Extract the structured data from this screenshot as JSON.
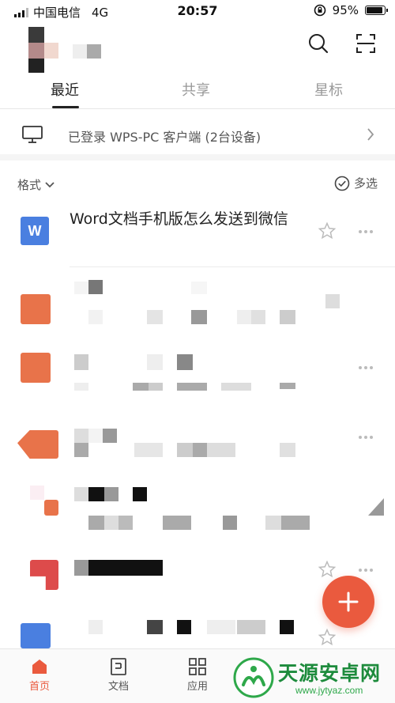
{
  "status_bar": {
    "carrier": "中国电信",
    "network": "4G",
    "time": "20:57",
    "battery": "95%",
    "battery_level": 0.95
  },
  "tabs": [
    {
      "label": "最近"
    },
    {
      "label": "共享"
    },
    {
      "label": "星标"
    }
  ],
  "device_row": {
    "label": "已登录 WPS-PC 客户端 (2台设备)"
  },
  "filter": {
    "format_label": "格式",
    "multi_select_label": "多选"
  },
  "files": [
    {
      "title": "Word文档手机版怎么发送到微信",
      "icon_letter": "W",
      "icon_color": "#4a7fe0"
    }
  ],
  "colors": {
    "accent": "#ea5a3e",
    "word_blue": "#4a7fe0",
    "ppt_orange": "#e8734a",
    "pdf_red": "#dd4b4b"
  },
  "bottom_nav": [
    {
      "label": "首页"
    },
    {
      "label": "文档"
    },
    {
      "label": "应用"
    }
  ],
  "watermark": {
    "brand": "天源安卓网",
    "url": "www.jytyaz.com"
  }
}
